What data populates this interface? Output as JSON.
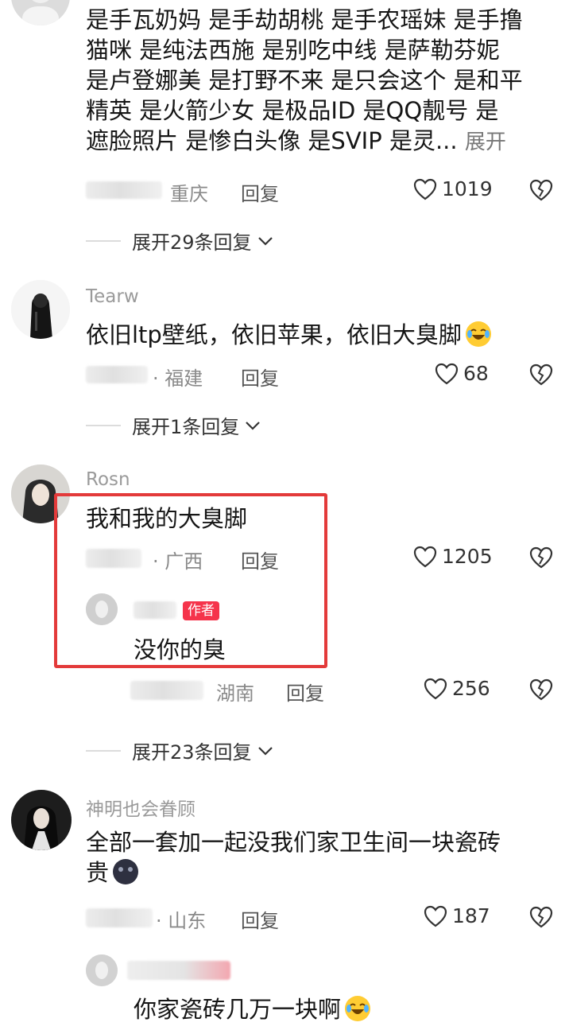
{
  "comment1": {
    "lines": [
      "是手瓦奶妈 是手劫胡桃 是手农瑶妹 是手撸",
      "猫咪 是纯法西施 是别吃中线 是萨勒芬妮",
      "是卢登娜美 是打野不来 是只会这个 是和平",
      "精英 是火箭少女 是极品ID   是QQ靓号 是",
      "遮脸照片 是惨白头像 是SVIP 是灵..."
    ],
    "expand_label": "展开",
    "location": "重庆",
    "reply_label": "回复",
    "likes": "1019",
    "expand_replies": "展开29条回复"
  },
  "comment2": {
    "username": "Tearw",
    "text": "依旧ltp壁纸，依旧苹果，依旧大臭脚",
    "location": "· 福建",
    "reply_label": "回复",
    "likes": "68",
    "expand_replies": "展开1条回复"
  },
  "comment3": {
    "username": "Rosn",
    "text": "我和我的大臭脚",
    "location": "· 广西",
    "reply_label": "回复",
    "likes": "1205",
    "reply": {
      "author_tag": "作者",
      "text": "没你的臭",
      "location": "湖南",
      "reply_label": "回复",
      "likes": "256"
    },
    "expand_replies": "展开23条回复"
  },
  "comment4": {
    "username": "神明也会眷顾",
    "line1": "全部一套加一起没我们家卫生间一块瓷砖",
    "line2": "贵",
    "location": "· 山东",
    "reply_label": "回复",
    "likes": "187",
    "reply": {
      "text": "你家瓷砖几万一块啊"
    }
  },
  "colors": {
    "highlight_frame": "#e33a3a",
    "author_tag": "#f5344b"
  },
  "icons": {
    "like": "heart-outline-icon",
    "dislike": "broken-heart-icon",
    "chevron": "chevron-down-icon",
    "emoji_laugh": "tears-of-joy-emoji",
    "emoji_dark": "dark-face-emoji"
  }
}
